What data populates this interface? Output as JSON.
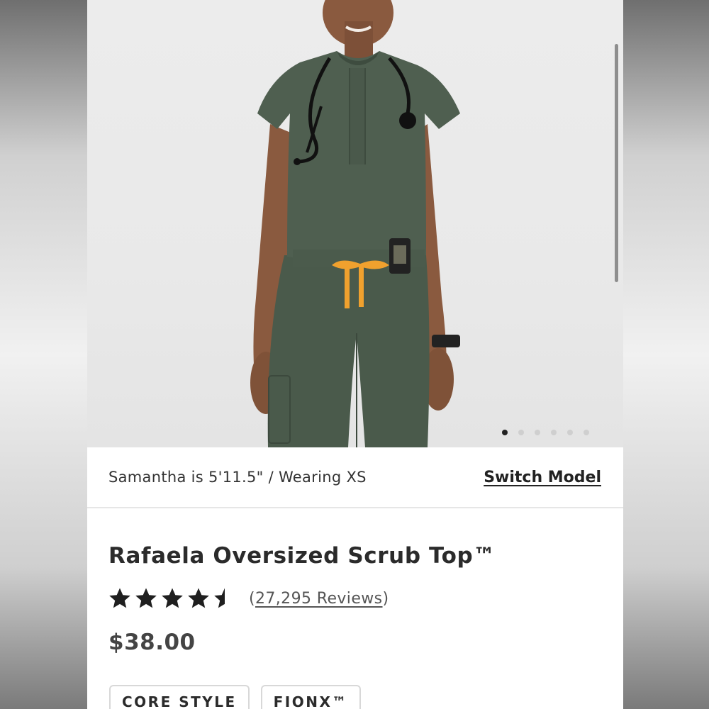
{
  "gallery": {
    "slide_count": 6,
    "active_index": 0
  },
  "model_info": {
    "description": "Samantha is 5'11.5\" / Wearing XS",
    "switch_label": "Switch Model"
  },
  "product": {
    "title": "Rafaela Oversized Scrub Top™",
    "rating": 4.5,
    "rating_max": 5,
    "reviews_open": "(",
    "reviews_label": "27,295 Reviews",
    "reviews_close": ")",
    "price": "$38.00",
    "tags": [
      "CORE STYLE",
      "FIONX™"
    ]
  },
  "colors": {
    "scrub_green": "#4a5a4b",
    "drawstring_orange": "#f0a12e",
    "star": "#1f1f1f"
  }
}
